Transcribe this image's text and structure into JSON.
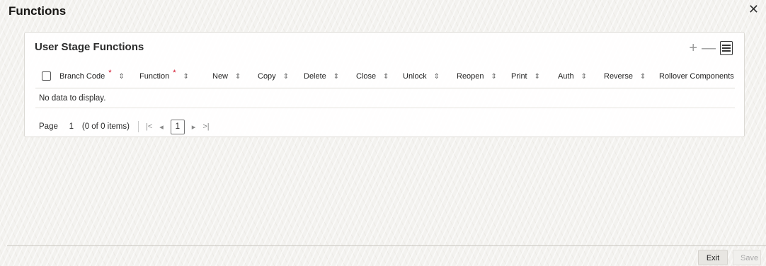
{
  "window": {
    "title": "Functions",
    "close_icon": "close-icon"
  },
  "panel": {
    "title": "User Stage Functions",
    "tools": {
      "add": "+",
      "remove": "—"
    },
    "columns": [
      {
        "label": "Branch Code",
        "required": "*"
      },
      {
        "label": "Function",
        "required": "*"
      },
      {
        "label": "New"
      },
      {
        "label": "Copy"
      },
      {
        "label": "Delete"
      },
      {
        "label": "Close"
      },
      {
        "label": "Unlock"
      },
      {
        "label": "Reopen"
      },
      {
        "label": "Print"
      },
      {
        "label": "Auth"
      },
      {
        "label": "Reverse"
      },
      {
        "label": "Rollover Components"
      }
    ],
    "empty_message": "No data to display.",
    "pager": {
      "page_label": "Page",
      "page_number": "1",
      "count": "(0 of 0 items)",
      "first": "|<",
      "prev": "◂",
      "current": "1",
      "next": "▸",
      "last": ">|"
    }
  },
  "footer": {
    "exit_label": "Exit",
    "save_label": "Save"
  }
}
